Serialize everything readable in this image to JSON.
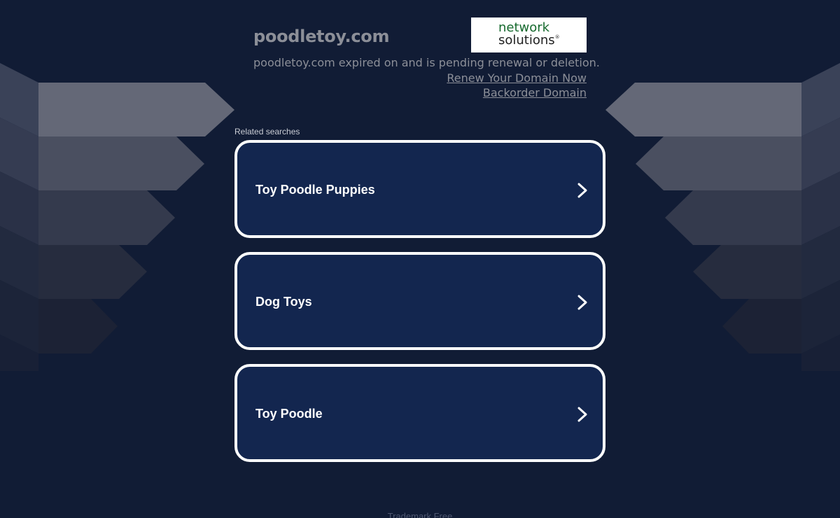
{
  "header": {
    "domain": "poodletoy.com",
    "status_message": "poodletoy.com expired on and is pending renewal or deletion.",
    "renew_link": "Renew Your Domain Now",
    "backorder_link": "Backorder Domain"
  },
  "logo": {
    "line1": "network",
    "line2": "solutions",
    "reg": "®"
  },
  "related": {
    "label": "Related searches",
    "items": [
      {
        "label": "Toy Poodle Puppies",
        "icon": "chevron-right-icon"
      },
      {
        "label": "Dog Toys",
        "icon": "chevron-right-icon"
      },
      {
        "label": "Toy Poodle",
        "icon": "chevron-right-icon"
      }
    ]
  },
  "footer": {
    "text": "Trademark Free"
  },
  "colors": {
    "background": "#111c35",
    "card_fill": "#13264f",
    "card_border": "#ffffff",
    "muted_text": "#8c8f98",
    "logo_green": "#166a2e"
  }
}
